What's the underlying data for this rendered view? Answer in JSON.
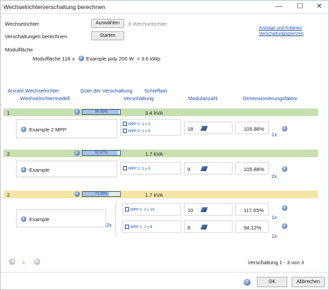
{
  "window": {
    "title": "Wechselrichterverschaltung berechnen"
  },
  "top": {
    "wr_label": "Wechselrichter",
    "select_label": "Auswählen",
    "wr_count": "6 Wechselrichter",
    "calc_label": "Verschaltungen berechnen",
    "start_label": "Starten",
    "link_text_1": "Anzeige und Kriterien",
    "link_text_2": "Verschaltungsgrenzen",
    "modulflaeche_label": "Modulfläche",
    "modul_area": "Modulfläche 1",
    "modul_count": "18",
    "modul_x": "x",
    "modul_name": "Example poly 200 W",
    "modul_power": "= 3.6 kWp"
  },
  "columns": {
    "count": "Anzahl Wechselrichter",
    "quality": "Güte der Verschaltung",
    "skewed": "Schieflast",
    "model": "Wechselrichtermodell",
    "wiring": "Verschaltung",
    "modules": "Modulanzahl",
    "factor": "Dimensionierungsfaktor"
  },
  "groups": [
    {
      "num": "1",
      "quality": 0.96,
      "quality_text": "96.00%",
      "power": "3.4 kVA",
      "model": "Example 2 MPP",
      "mppts": [
        "MPP 1: 1 x 9",
        "MPP 2: 1 x 9"
      ],
      "modules": "18",
      "factor": "105.88%",
      "mult": "1x"
    },
    {
      "num": "2",
      "quality": 0.9267,
      "quality_text": "92.67%",
      "power": "1.7 kVA",
      "model": "Example",
      "mppts": [
        "MPP 1: 1 x 9"
      ],
      "modules": "9",
      "factor": "105.88%",
      "mult": "2x"
    },
    {
      "num": "2",
      "quality": 0.71,
      "quality_text": "71.00%",
      "power": "1.7 kVA",
      "model": "Example",
      "model_mult": "2x",
      "subs": [
        {
          "mppt": "MPP 1: 1 x 10",
          "modules": "10",
          "factor": "117.65%",
          "mult": "1x"
        },
        {
          "mppt": "MPP 1: 1 x 8",
          "modules": "8",
          "factor": "94.12%",
          "mult": "1x"
        }
      ]
    }
  ],
  "paging": {
    "page": "1",
    "status": "Verschaltung 1 - 3 von 3"
  },
  "footer": {
    "ok": "OK",
    "cancel": "Abbrechen"
  },
  "colors": {
    "green": "#c8dfb2",
    "yellow": "#f6e6a6",
    "link": "#1d4fa8"
  }
}
